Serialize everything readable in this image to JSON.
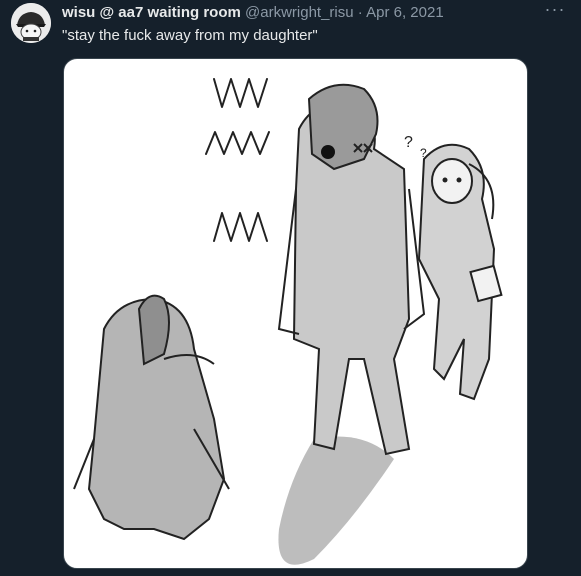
{
  "tweet": {
    "display_name": "wisu @ aa7 waiting room",
    "handle": "@arkwright_risu",
    "separator": "·",
    "date": "Apr 6, 2021",
    "text": "\"stay the fuck away from my daughter\"",
    "more_icon": "more-horizontal-icon"
  },
  "media": {
    "annotations": [
      "?"
    ]
  },
  "colors": {
    "background": "#15202b",
    "text_primary": "#e7e9ea",
    "text_secondary": "#8b98a5",
    "border": "#38444d"
  }
}
